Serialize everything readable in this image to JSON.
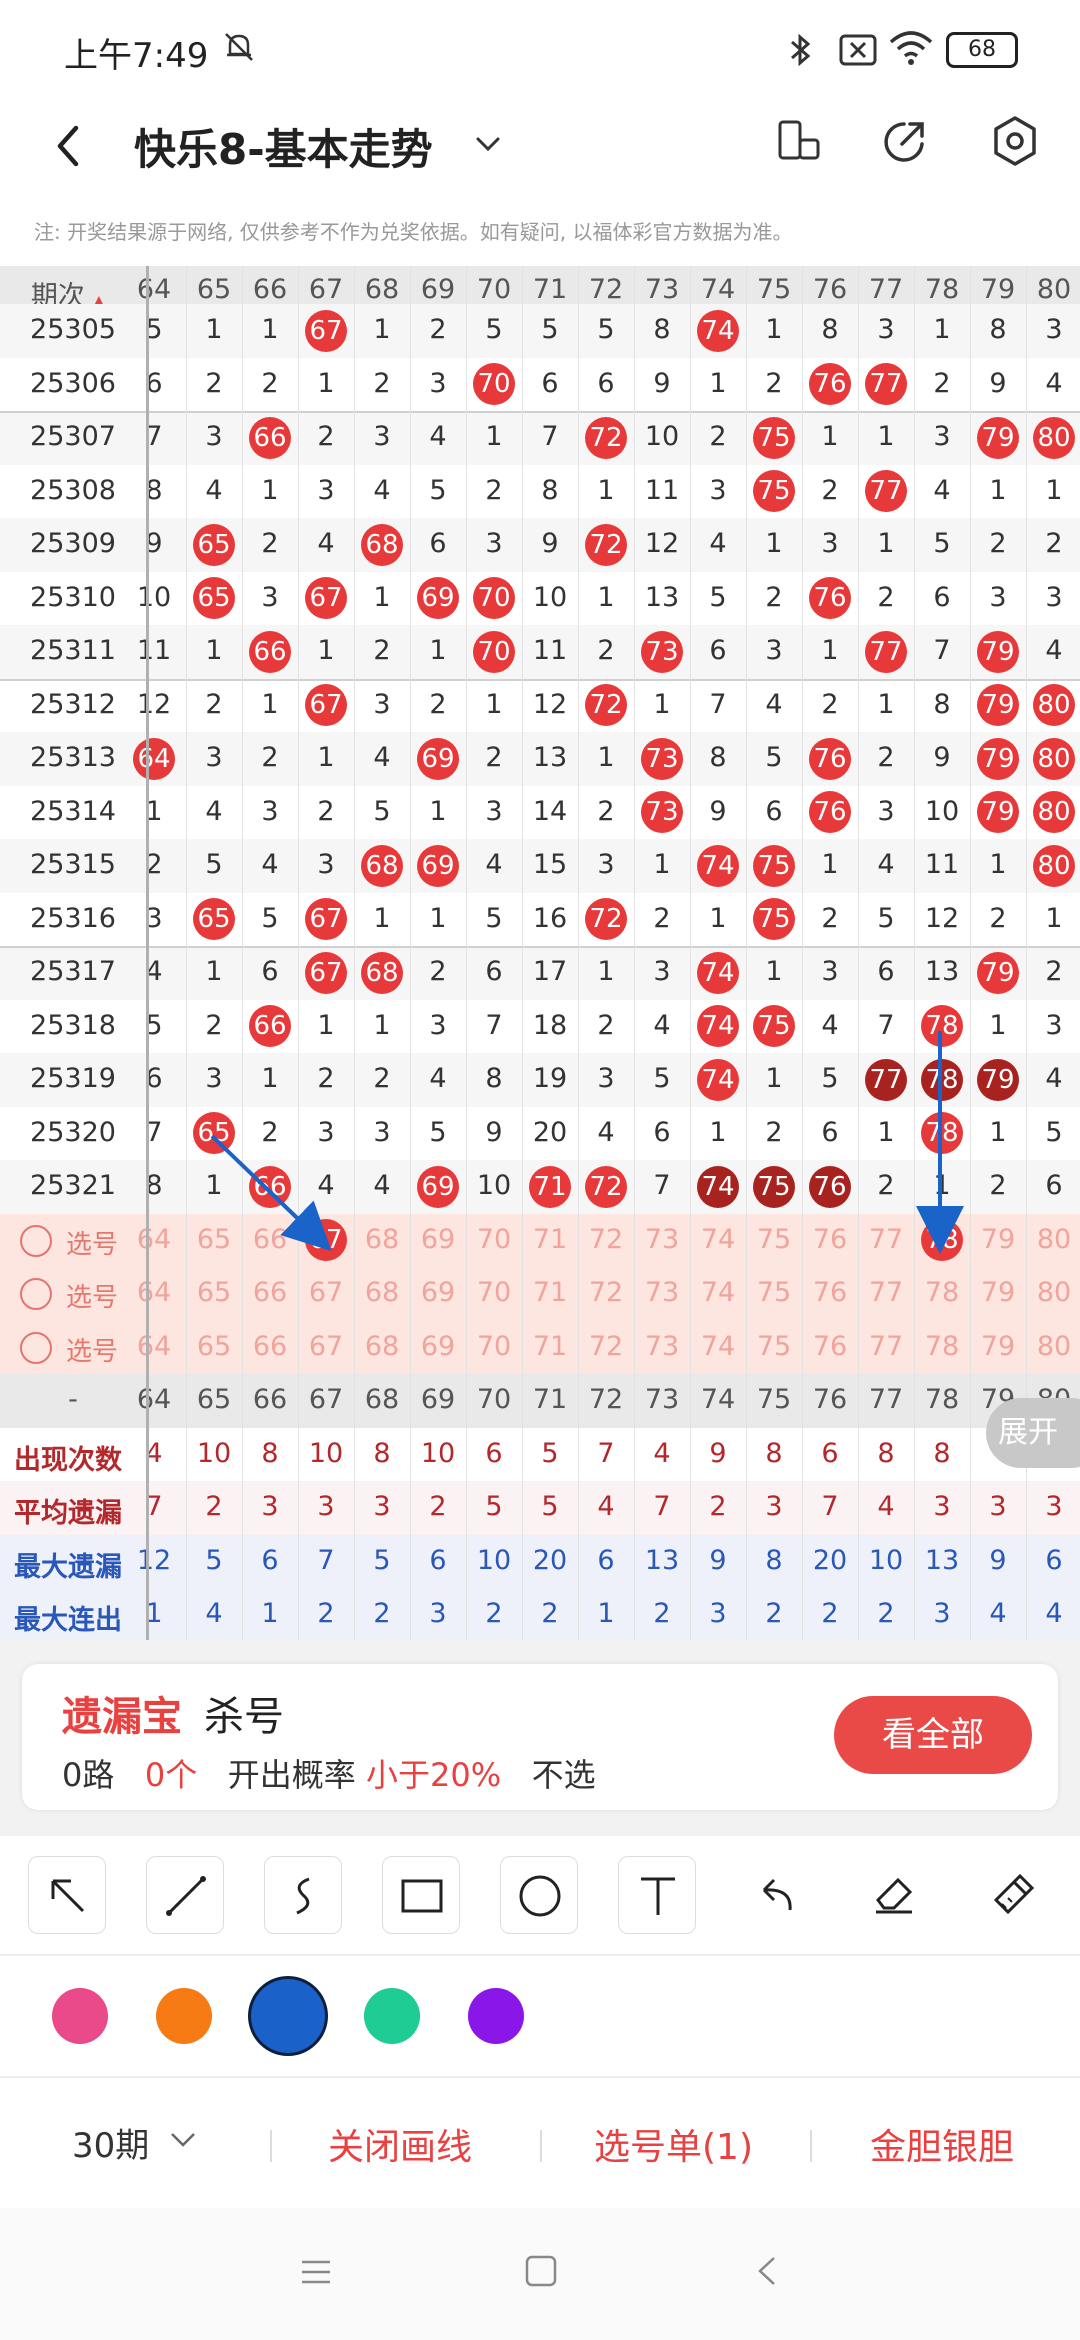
{
  "status_bar": {
    "time": "上午7:49",
    "battery": "68"
  },
  "header": {
    "title": "快乐8-基本走势"
  },
  "notice": "注: 开奖结果源于网络, 仅供参考不作为兑奖依据。如有疑问, 以福体彩官方数据为准。",
  "grid": {
    "corner_label": "期次",
    "columns": [
      "64",
      "65",
      "66",
      "67",
      "68",
      "69",
      "70",
      "71",
      "72",
      "73",
      "74",
      "75",
      "76",
      "77",
      "78",
      "79",
      "80"
    ],
    "rows": [
      {
        "period": "25305",
        "cells": [
          "5",
          "1",
          "1",
          "67",
          "1",
          "2",
          "5",
          "5",
          "5",
          "8",
          "74",
          "1",
          "8",
          "3",
          "1",
          "8",
          "3"
        ]
      },
      {
        "period": "25306",
        "cells": [
          "6",
          "2",
          "2",
          "1",
          "2",
          "3",
          "70",
          "6",
          "6",
          "9",
          "1",
          "2",
          "76",
          "77",
          "2",
          "9",
          "4"
        ]
      },
      {
        "period": "25307",
        "cells": [
          "7",
          "3",
          "66",
          "2",
          "3",
          "4",
          "1",
          "7",
          "72",
          "10",
          "2",
          "75",
          "1",
          "1",
          "3",
          "79",
          "80"
        ]
      },
      {
        "period": "25308",
        "cells": [
          "8",
          "4",
          "1",
          "3",
          "4",
          "5",
          "2",
          "8",
          "1",
          "11",
          "3",
          "75",
          "2",
          "77",
          "4",
          "1",
          "1"
        ]
      },
      {
        "period": "25309",
        "cells": [
          "9",
          "65",
          "2",
          "4",
          "68",
          "6",
          "3",
          "9",
          "72",
          "12",
          "4",
          "1",
          "3",
          "1",
          "5",
          "2",
          "2"
        ]
      },
      {
        "period": "25310",
        "cells": [
          "10",
          "65",
          "3",
          "67",
          "1",
          "69",
          "70",
          "10",
          "1",
          "13",
          "5",
          "2",
          "76",
          "2",
          "6",
          "3",
          "3"
        ]
      },
      {
        "period": "25311",
        "cells": [
          "11",
          "1",
          "66",
          "1",
          "2",
          "1",
          "70",
          "11",
          "2",
          "73",
          "6",
          "3",
          "1",
          "77",
          "7",
          "79",
          "4"
        ]
      },
      {
        "period": "25312",
        "cells": [
          "12",
          "2",
          "1",
          "67",
          "3",
          "2",
          "1",
          "12",
          "72",
          "1",
          "7",
          "4",
          "2",
          "1",
          "8",
          "79",
          "80"
        ]
      },
      {
        "period": "25313",
        "cells": [
          "64",
          "3",
          "2",
          "1",
          "4",
          "69",
          "2",
          "13",
          "1",
          "73",
          "8",
          "5",
          "76",
          "2",
          "9",
          "79",
          "80"
        ]
      },
      {
        "period": "25314",
        "cells": [
          "1",
          "4",
          "3",
          "2",
          "5",
          "1",
          "3",
          "14",
          "2",
          "73",
          "9",
          "6",
          "76",
          "3",
          "10",
          "79",
          "80"
        ]
      },
      {
        "period": "25315",
        "cells": [
          "2",
          "5",
          "4",
          "3",
          "68",
          "69",
          "4",
          "15",
          "3",
          "1",
          "74",
          "75",
          "1",
          "4",
          "11",
          "1",
          "80"
        ]
      },
      {
        "period": "25316",
        "cells": [
          "3",
          "65",
          "5",
          "67",
          "1",
          "1",
          "5",
          "16",
          "72",
          "2",
          "1",
          "75",
          "2",
          "5",
          "12",
          "2",
          "1"
        ]
      },
      {
        "period": "25317",
        "cells": [
          "4",
          "1",
          "6",
          "67",
          "68",
          "2",
          "6",
          "17",
          "1",
          "3",
          "74",
          "1",
          "3",
          "6",
          "13",
          "79",
          "2"
        ]
      },
      {
        "period": "25318",
        "cells": [
          "5",
          "2",
          "66",
          "1",
          "1",
          "3",
          "7",
          "18",
          "2",
          "4",
          "74",
          "75",
          "4",
          "7",
          "78",
          "1",
          "3"
        ]
      },
      {
        "period": "25319",
        "cells": [
          "6",
          "3",
          "1",
          "2",
          "2",
          "4",
          "8",
          "19",
          "3",
          "5",
          "74",
          "1",
          "5",
          "77",
          "78",
          "79",
          "4"
        ]
      },
      {
        "period": "25320",
        "cells": [
          "7",
          "65",
          "2",
          "3",
          "3",
          "5",
          "9",
          "20",
          "4",
          "6",
          "1",
          "2",
          "6",
          "1",
          "78",
          "1",
          "5"
        ]
      },
      {
        "period": "25321",
        "cells": [
          "8",
          "1",
          "66",
          "4",
          "4",
          "69",
          "10",
          "71",
          "72",
          "7",
          "74",
          "75",
          "76",
          "2",
          "1",
          "2",
          "6"
        ]
      }
    ],
    "pick_label": "选号",
    "pick_rows": 3,
    "pick_selected": [
      "67",
      "78"
    ],
    "footer_label": "-",
    "stats": [
      {
        "label": "出现次数",
        "color": "#b3282d",
        "values": [
          "4",
          "10",
          "8",
          "10",
          "8",
          "10",
          "6",
          "5",
          "7",
          "4",
          "9",
          "8",
          "6",
          "8",
          "8",
          "",
          ""
        ]
      },
      {
        "label": "平均遗漏",
        "color": "#b3282d",
        "values": [
          "7",
          "2",
          "3",
          "3",
          "3",
          "2",
          "5",
          "5",
          "4",
          "7",
          "2",
          "3",
          "7",
          "4",
          "3",
          "3",
          "3"
        ]
      },
      {
        "label": "最大遗漏",
        "color": "#2a58b8",
        "values": [
          "12",
          "5",
          "6",
          "7",
          "5",
          "6",
          "10",
          "20",
          "6",
          "13",
          "9",
          "8",
          "20",
          "10",
          "13",
          "9",
          "6"
        ]
      },
      {
        "label": "最大连出",
        "color": "#2a58b8",
        "values": [
          "1",
          "4",
          "1",
          "2",
          "2",
          "3",
          "2",
          "2",
          "1",
          "2",
          "3",
          "2",
          "2",
          "2",
          "3",
          "4",
          "4"
        ]
      }
    ],
    "expand_label": "展开",
    "dark_balls": [
      [
        "25319",
        "77"
      ],
      [
        "25319",
        "78"
      ],
      [
        "25319",
        "79"
      ],
      [
        "25321",
        "74"
      ],
      [
        "25321",
        "75"
      ],
      [
        "25321",
        "76"
      ]
    ]
  },
  "promo": {
    "title_red": "遗漏宝",
    "title_black": "杀号",
    "road": "0路",
    "count": "0个",
    "prob_label": "开出概率",
    "prob_value": "小于20%",
    "action": "不选",
    "button": "看全部"
  },
  "tools": [
    "arrow-tool-icon",
    "line-tool-icon",
    "curve-tool-icon",
    "rect-tool-icon",
    "circle-tool-icon",
    "text-tool-icon",
    "undo-icon",
    "eraser-icon",
    "clear-brush-icon"
  ],
  "palette": [
    "#ea4a8a",
    "#f77b14",
    "#1a61c9",
    "#1fcc94",
    "#8a16e8"
  ],
  "bottom_bar": {
    "period": "30期",
    "close_draw": "关闭画线",
    "pick_list": "选号单(1)",
    "gold": "金胆银胆"
  },
  "colors": {
    "accent": "#e84140",
    "ball_red": "#e8393a",
    "ball_dark": "#a8231f",
    "arrow_blue": "#1a63c9"
  }
}
